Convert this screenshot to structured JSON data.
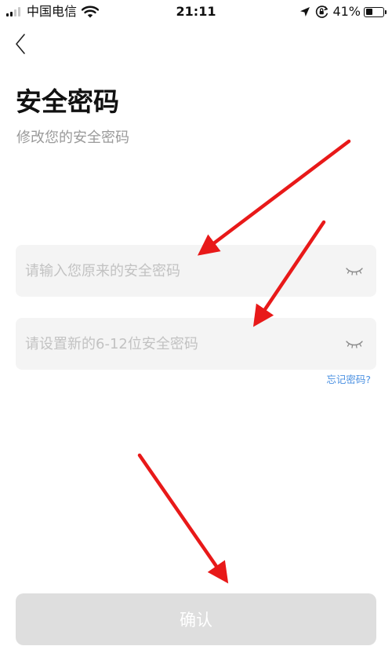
{
  "status_bar": {
    "carrier": "中国电信",
    "time": "21:11",
    "battery_percent": "41%",
    "battery_level": 0.41,
    "signal_bars_filled": 2,
    "signal_bars_total": 4,
    "icons": [
      "signal-icon",
      "wifi-icon",
      "location-arrow-icon",
      "orientation-lock-icon",
      "battery-icon"
    ]
  },
  "header": {
    "back_icon": "chevron-left-icon",
    "title": "安全密码",
    "subtitle": "修改您的安全密码"
  },
  "form": {
    "old_password": {
      "value": "",
      "placeholder": "请输入您原来的安全密码",
      "toggle_icon": "eye-closed-icon"
    },
    "new_password": {
      "value": "",
      "placeholder": "请设置新的6-12位安全密码",
      "toggle_icon": "eye-closed-icon"
    },
    "forgot_link": "忘记密码?"
  },
  "confirm_button": {
    "label": "确认",
    "enabled": false
  },
  "annotation_color": "#e81919",
  "colors": {
    "field_background": "#f4f4f4",
    "placeholder": "#c2c2c2",
    "link": "#4a90e2",
    "disabled_button": "#dedede",
    "subtitle": "#9a9a9a"
  }
}
